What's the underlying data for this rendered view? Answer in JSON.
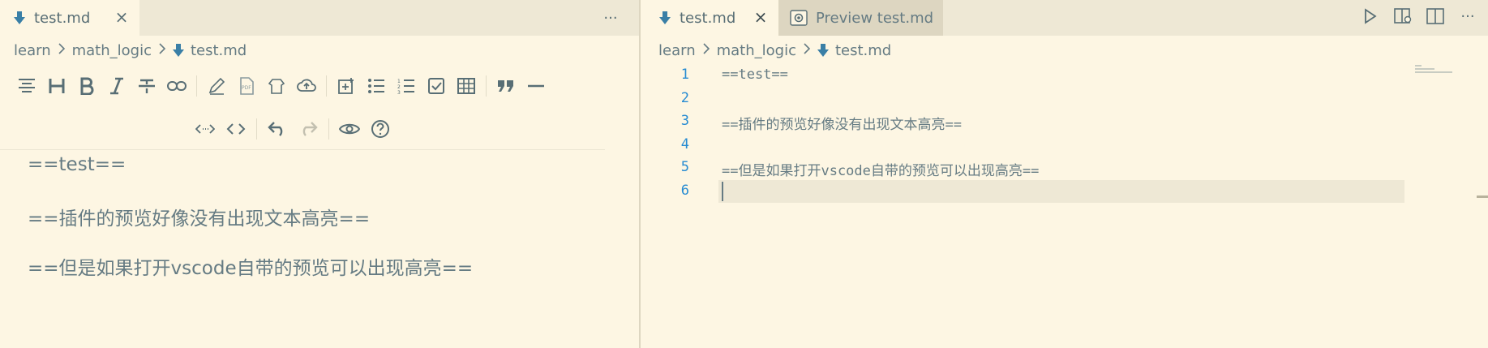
{
  "left_pane": {
    "tab": {
      "label": "test.md",
      "close": "×"
    },
    "more_actions": "···",
    "breadcrumb": {
      "folder1": "learn",
      "folder2": "math_logic",
      "file": "test.md"
    },
    "preview_lines": [
      "==test==",
      "==插件的预览好像没有出现文本高亮==",
      "==但是如果打开vscode自带的预览可以出现高亮=="
    ]
  },
  "right_pane": {
    "tabs": [
      {
        "label": "test.md",
        "close": "×"
      },
      {
        "label": "Preview test.md"
      }
    ],
    "breadcrumb": {
      "folder1": "learn",
      "folder2": "math_logic",
      "file": "test.md"
    },
    "editor_lines": [
      {
        "num": "1",
        "text": "==test=="
      },
      {
        "num": "2",
        "text": ""
      },
      {
        "num": "3",
        "text": "==插件的预览好像没有出现文本高亮=="
      },
      {
        "num": "4",
        "text": ""
      },
      {
        "num": "5",
        "text": "==但是如果打开vscode自带的预览可以出现高亮=="
      },
      {
        "num": "6",
        "text": ""
      }
    ],
    "more_actions": "···"
  },
  "colors": {
    "background": "#fdf6e3",
    "tab_bar": "#eee8d5",
    "text": "#657b83",
    "line_number": "#268bd2",
    "markdown_icon": "#3a7fa6"
  },
  "icons": [
    "markdown-file-icon",
    "close-icon",
    "more-actions-icon",
    "chevron-right-icon",
    "preview-icon",
    "run-icon",
    "open-preview-side-icon",
    "split-editor-icon"
  ]
}
